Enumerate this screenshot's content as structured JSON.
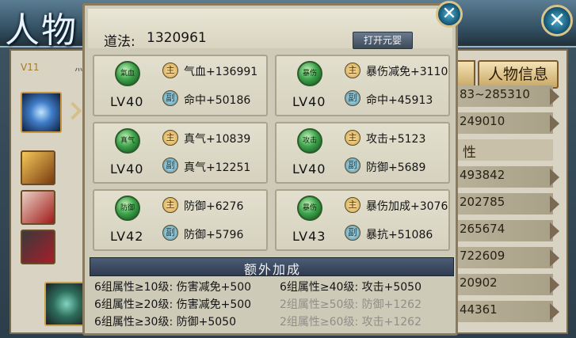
{
  "background": {
    "title": "人物",
    "vip": "V11",
    "level_fragment": "灬",
    "close_symbol": "✕",
    "tab_label": "人物信息",
    "rows": [
      {
        "value": "83~285310",
        "kind": "row"
      },
      {
        "value": "249010",
        "kind": "row"
      },
      {
        "value": "性",
        "kind": "header"
      },
      {
        "value": "493842",
        "kind": "row"
      },
      {
        "value": "202785",
        "kind": "row"
      },
      {
        "value": "265674",
        "kind": "row"
      },
      {
        "value": "722609",
        "kind": "row"
      },
      {
        "value": "20902",
        "kind": "row"
      },
      {
        "value": "44361",
        "kind": "row"
      }
    ]
  },
  "dialog": {
    "daofa_label": "道法:",
    "daofa_value": "1320961",
    "open_button": "打开元婴",
    "close_symbol": "✕",
    "main_tag": "主",
    "sub_tag": "副",
    "cards": [
      {
        "jewel": "氣血",
        "level": "LV40",
        "main": "气血+136991",
        "sub": "命中+50186"
      },
      {
        "jewel": "暴伤",
        "level": "LV40",
        "main": "暴伤减免+3110",
        "sub": "命中+45913"
      },
      {
        "jewel": "真气",
        "level": "LV40",
        "main": "真气+10839",
        "sub": "真气+12251"
      },
      {
        "jewel": "攻击",
        "level": "LV40",
        "main": "攻击+5123",
        "sub": "防御+5689"
      },
      {
        "jewel": "防御",
        "level": "LV42",
        "main": "防御+6276",
        "sub": "防御+5796"
      },
      {
        "jewel": "暴伤",
        "level": "LV43",
        "main": "暴伤加成+3076",
        "sub": "暴抗+51086"
      }
    ],
    "extra_title": "额外加成",
    "bonuses": [
      {
        "text": "6组属性≥10级: 伤害减免+500",
        "active": true
      },
      {
        "text": "6组属性≥40级: 攻击+5050",
        "active": true
      },
      {
        "text": "6组属性≥20级: 伤害减免+500",
        "active": true
      },
      {
        "text": "2组属性≥50级: 防御+1262",
        "active": false
      },
      {
        "text": "6组属性≥30级: 防御+5050",
        "active": true
      },
      {
        "text": "2组属性≥60级: 攻击+1262",
        "active": false
      }
    ]
  }
}
